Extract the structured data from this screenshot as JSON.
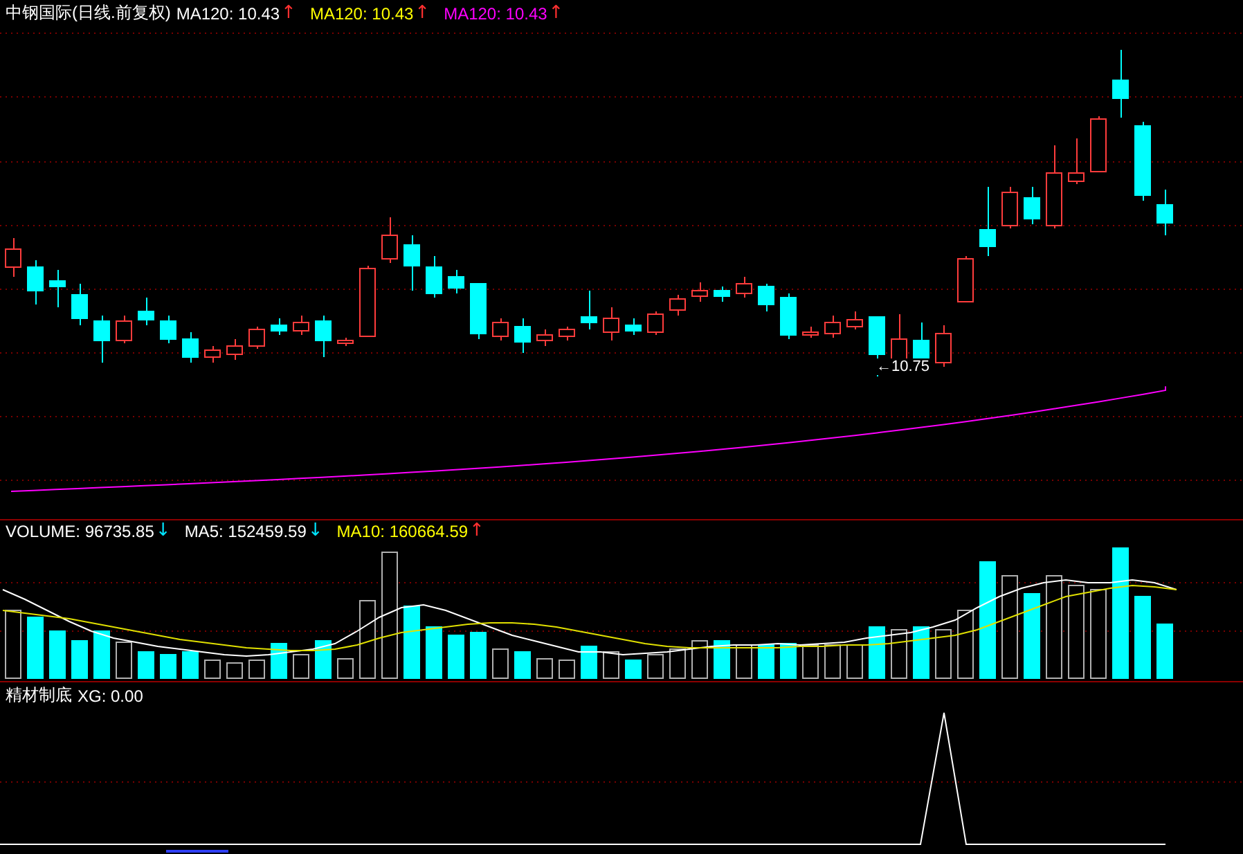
{
  "price_panel": {
    "title": "中钢国际(日线.前复权)",
    "indicators": [
      {
        "label": "MA120: 10.43",
        "color": "#ffffff",
        "arrow": {
          "text": "↑",
          "color": "#ff3030"
        }
      },
      {
        "label": "MA120: 10.43",
        "color": "#ffff00",
        "arrow": {
          "text": "↑",
          "color": "#ff3030"
        }
      },
      {
        "label": "MA120: 10.43",
        "color": "#ff00ff",
        "arrow": {
          "text": "↑",
          "color": "#ff3030"
        }
      }
    ],
    "low_marker": "←10.75"
  },
  "volume_panel": {
    "indicators": [
      {
        "label": "VOLUME: 96735.85",
        "color": "#ffffff",
        "arrow": {
          "text": "↓",
          "color": "#00e5ff"
        }
      },
      {
        "label": "MA5: 152459.59",
        "color": "#ffffff",
        "arrow": {
          "text": "↓",
          "color": "#00e5ff"
        }
      },
      {
        "label": "MA10: 160664.59",
        "color": "#ffff00",
        "arrow": {
          "text": "↑",
          "color": "#ff3030"
        }
      }
    ]
  },
  "signal_panel": {
    "title": "精材制底",
    "indicators": [
      {
        "label": "XG: 0.00",
        "color": "#ffffff"
      }
    ]
  }
}
